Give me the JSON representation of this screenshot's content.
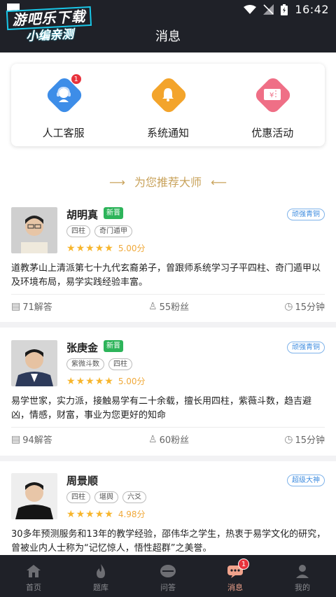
{
  "status_bar": {
    "time": "16:42"
  },
  "watermark": {
    "line1": "游吧乐下载",
    "line2": "小编亲测"
  },
  "header": {
    "title": "消息"
  },
  "quick_actions": [
    {
      "label": "人工客服",
      "icon": "customer-service-icon",
      "color": "#3d8de8",
      "badge": "1"
    },
    {
      "label": "系统通知",
      "icon": "bell-icon",
      "color": "#f3a42b",
      "badge": ""
    },
    {
      "label": "优惠活动",
      "icon": "coupon-icon",
      "color": "#ef6f86",
      "badge": ""
    }
  ],
  "recommend": {
    "title": "为您推荐大师",
    "left_mark": "⟶",
    "right_mark": "⟵"
  },
  "masters": [
    {
      "name": "胡明真",
      "new_label": "新晋",
      "level": "顽强青铜",
      "tags": [
        "四柱",
        "奇门遁甲"
      ],
      "rating": "5.00分",
      "intro": "道教茅山上清派第七十九代玄裔弟子，曾跟师系统学习子平四柱、奇门遁甲以及环境布局，易学实践经验丰富。",
      "answers": "71解答",
      "fans": "55粉丝",
      "duration": "15分钟"
    },
    {
      "name": "张庚金",
      "new_label": "新晋",
      "level": "顽强青铜",
      "tags": [
        "紫微斗数",
        "四柱"
      ],
      "rating": "5.00分",
      "intro": "易学世家，实力派，接触易学有二十余载，擅长用四柱，紫薇斗数，趋吉避凶，情感，财富，事业为您更好的知命",
      "answers": "94解答",
      "fans": "60粉丝",
      "duration": "15分钟"
    },
    {
      "name": "周景顺",
      "new_label": "",
      "level": "超级大神",
      "tags": [
        "四柱",
        "堪舆",
        "六爻"
      ],
      "rating": "4.98分",
      "intro": "30多年预测服务和13年的教学经验，邵伟华之学生，热衷于易学文化的研究，曾被业内人士称为“记忆惊人，悟性超群”之美誉。",
      "answers": "",
      "fans": "",
      "duration": ""
    }
  ],
  "tabs": [
    {
      "label": "首页",
      "icon": "home-icon",
      "active": false,
      "badge": ""
    },
    {
      "label": "题库",
      "icon": "fire-icon",
      "active": false,
      "badge": ""
    },
    {
      "label": "问答",
      "icon": "qa-icon",
      "active": false,
      "badge": ""
    },
    {
      "label": "消息",
      "icon": "message-icon",
      "active": true,
      "badge": "1"
    },
    {
      "label": "我的",
      "icon": "profile-icon",
      "active": false,
      "badge": ""
    }
  ],
  "colors": {
    "header_bg": "#1f2128",
    "accent_gold": "#c9a35c",
    "star": "#f7b52c",
    "active_tab": "#f1a38c",
    "new_tag": "#2db45a",
    "level_tag": "#3f8de0"
  }
}
